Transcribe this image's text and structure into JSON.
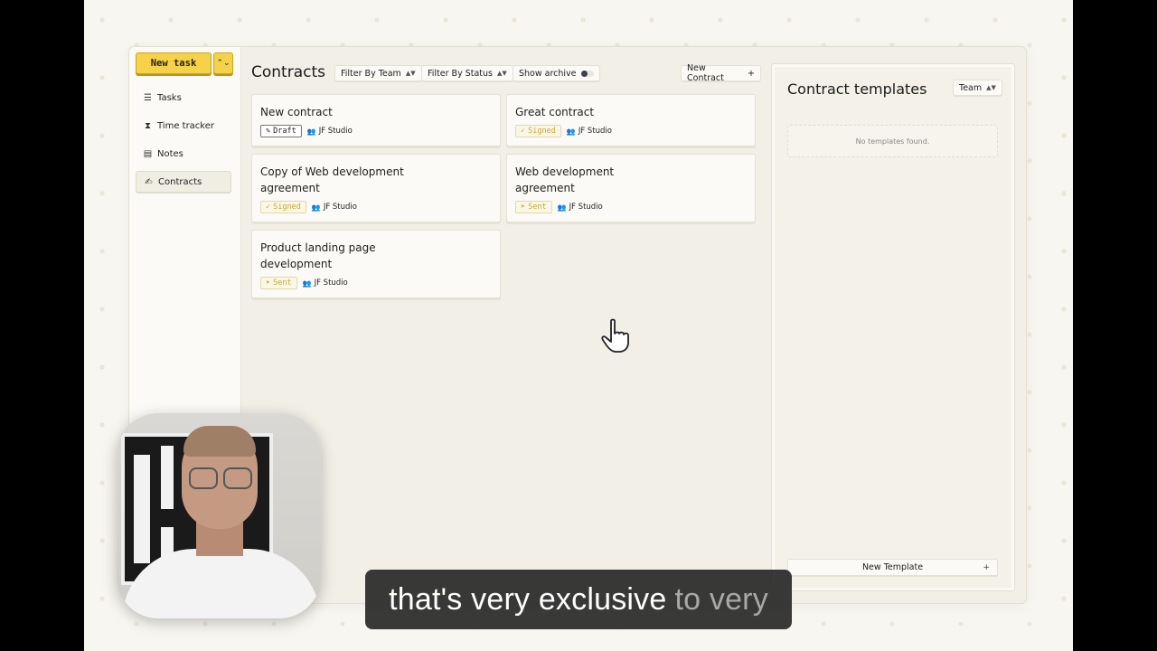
{
  "sidebar": {
    "new_task_label": "New task",
    "items": [
      {
        "label": "Tasks",
        "icon": "list-icon"
      },
      {
        "label": "Time tracker",
        "icon": "hourglass-icon"
      },
      {
        "label": "Notes",
        "icon": "notes-icon"
      },
      {
        "label": "Contracts",
        "icon": "contract-icon",
        "active": true
      }
    ]
  },
  "main": {
    "title": "Contracts",
    "filter_team": "Filter By Team",
    "filter_status": "Filter By Status",
    "show_archive": "Show archive",
    "new_contract": "New Contract",
    "contracts": [
      {
        "title": "New contract",
        "status": "Draft",
        "team": "JF Studio"
      },
      {
        "title": "Great contract",
        "status": "Signed",
        "team": "JF Studio"
      },
      {
        "title": "Copy of Web development agreement",
        "status": "Signed",
        "team": "JF Studio"
      },
      {
        "title": "Web development agreement",
        "status": "Sent",
        "team": "JF Studio"
      },
      {
        "title": "Product landing page development",
        "status": "Sent",
        "team": "JF Studio"
      }
    ]
  },
  "templates": {
    "title": "Contract templates",
    "team_select": "Team",
    "empty_text": "No templates found.",
    "new_template": "New Template"
  },
  "caption": {
    "bright": "that's very exclusive",
    "dim": "to very"
  },
  "colors": {
    "accent_yellow": "#f5d24a",
    "badge_gold": "#c9a632",
    "panel_bg": "#f1efe6"
  }
}
